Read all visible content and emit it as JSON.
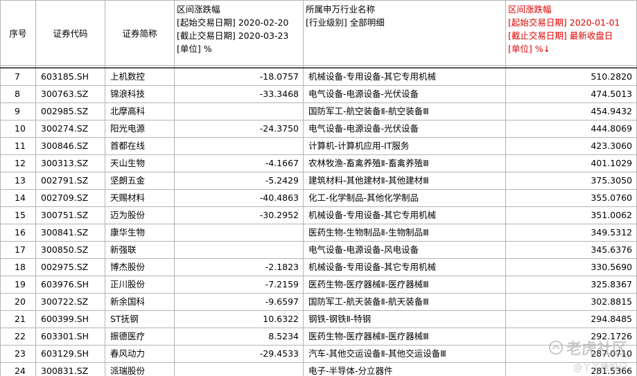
{
  "columns": {
    "idx": "序号",
    "code": "证券代码",
    "name": "证券简称",
    "chg1": [
      "区间涨跌幅",
      "[起始交易日期] 2020-02-20",
      "[截止交易日期] 2020-03-23",
      "[单位] %"
    ],
    "industry": [
      "所属申万行业名称",
      "[行业级别] 全部明细"
    ],
    "chg2": [
      "区间涨跌幅",
      "[起始交易日期] 2020-01-01",
      "[截止交易日期] 最新收盘日",
      "[单位] %↓"
    ]
  },
  "rows": [
    {
      "idx": "7",
      "code": "603185.SH",
      "name": "上机数控",
      "chg1": "-18.0757",
      "industry": "机械设备-专用设备-其它专用机械",
      "chg2": "510.2820"
    },
    {
      "idx": "8",
      "code": "300763.SZ",
      "name": "锦浪科技",
      "chg1": "-33.3468",
      "industry": "电气设备-电源设备-光伏设备",
      "chg2": "474.5013"
    },
    {
      "idx": "9",
      "code": "002985.SZ",
      "name": "北摩高科",
      "chg1": "",
      "industry": "国防军工-航空装备Ⅱ-航空装备Ⅲ",
      "chg2": "454.9432"
    },
    {
      "idx": "10",
      "code": "300274.SZ",
      "name": "阳光电源",
      "chg1": "-24.3750",
      "industry": "电气设备-电源设备-光伏设备",
      "chg2": "444.8069"
    },
    {
      "idx": "11",
      "code": "300846.SZ",
      "name": "首都在线",
      "chg1": "",
      "industry": "计算机-计算机应用-IT服务",
      "chg2": "423.3060"
    },
    {
      "idx": "12",
      "code": "300313.SZ",
      "name": "天山生物",
      "chg1": "-4.1667",
      "industry": "农林牧渔-畜禽养殖Ⅱ-畜禽养殖Ⅲ",
      "chg2": "401.1029"
    },
    {
      "idx": "13",
      "code": "002791.SZ",
      "name": "坚朗五金",
      "chg1": "-5.2429",
      "industry": "建筑材料-其他建材Ⅱ-其他建材Ⅲ",
      "chg2": "375.3050"
    },
    {
      "idx": "14",
      "code": "002709.SZ",
      "name": "天赐材料",
      "chg1": "-40.4863",
      "industry": "化工-化学制品-其他化学制品",
      "chg2": "355.0760"
    },
    {
      "idx": "15",
      "code": "300751.SZ",
      "name": "迈为股份",
      "chg1": "-30.2952",
      "industry": "机械设备-专用设备-其它专用机械",
      "chg2": "351.0062"
    },
    {
      "idx": "16",
      "code": "300841.SZ",
      "name": "康华生物",
      "chg1": "",
      "industry": "医药生物-生物制品Ⅱ-生物制品Ⅲ",
      "chg2": "349.5312"
    },
    {
      "idx": "17",
      "code": "300850.SZ",
      "name": "新强联",
      "chg1": "",
      "industry": "电气设备-电源设备-风电设备",
      "chg2": "345.6376"
    },
    {
      "idx": "18",
      "code": "002975.SZ",
      "name": "博杰股份",
      "chg1": "-2.1823",
      "industry": "机械设备-专用设备-其它专用机械",
      "chg2": "330.5690"
    },
    {
      "idx": "19",
      "code": "603976.SH",
      "name": "正川股份",
      "chg1": "-7.2159",
      "industry": "医药生物-医疗器械Ⅱ-医疗器械Ⅲ",
      "chg2": "325.8367"
    },
    {
      "idx": "20",
      "code": "300722.SZ",
      "name": "新余国科",
      "chg1": "-9.6597",
      "industry": "国防军工-航天装备Ⅱ-航天装备Ⅲ",
      "chg2": "302.8815"
    },
    {
      "idx": "21",
      "code": "600399.SH",
      "name": "ST抚钢",
      "chg1": "10.6322",
      "industry": "钢铁-钢铁Ⅱ-特钢",
      "chg2": "294.8485"
    },
    {
      "idx": "22",
      "code": "603301.SH",
      "name": "振德医疗",
      "chg1": "8.5234",
      "industry": "医药生物-医疗器械Ⅱ-医疗器械Ⅲ",
      "chg2": "292.1726"
    },
    {
      "idx": "23",
      "code": "603129.SH",
      "name": "春风动力",
      "chg1": "-29.4533",
      "industry": "汽车-其他交运设备Ⅱ-其他交运设备Ⅲ",
      "chg2": "287.0710"
    },
    {
      "idx": "24",
      "code": "300831.SZ",
      "name": "派瑞股份",
      "chg1": "",
      "industry": "电子-半导体-分立器件",
      "chg2": "281.5366"
    }
  ],
  "watermark": {
    "main": "老虎社区",
    "sub": "@丫丫撸股记"
  },
  "colors": {
    "header_red": "#e00000",
    "grid": "#b4b4b4"
  }
}
